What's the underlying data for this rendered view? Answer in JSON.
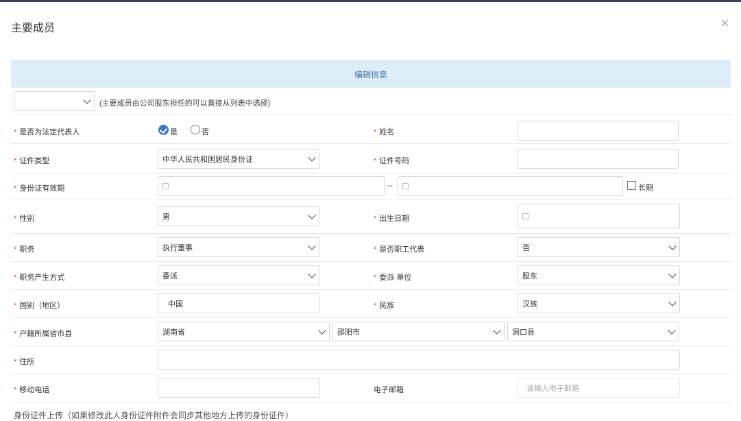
{
  "dialog": {
    "title": "主要成员"
  },
  "section": {
    "title": "编辑信息"
  },
  "member_select": {
    "value": "",
    "hint": "(主要成员由公司股东担任的可以直接从列表中选择)"
  },
  "form": {
    "legal_rep": {
      "label": "是否为法定代表人",
      "yes": "是",
      "no": "否",
      "selected": "是"
    },
    "name": {
      "label": "姓名",
      "value": ""
    },
    "id_type": {
      "label": "证件类型",
      "value": "中华人民共和国居民身份证"
    },
    "id_number": {
      "label": "证件号码",
      "value": ""
    },
    "id_validity": {
      "label": "身份证有效期",
      "start": "",
      "end": "",
      "separator": "--",
      "long_term": "长期"
    },
    "gender": {
      "label": "性别",
      "value": "男"
    },
    "birth_date": {
      "label": "出生日期",
      "value": ""
    },
    "position": {
      "label": "职务",
      "value": "执行董事"
    },
    "employee_rep": {
      "label": "是否职工代表",
      "value": "否"
    },
    "appoint_method": {
      "label": "职务产生方式",
      "value": "委派"
    },
    "appoint_unit": {
      "label": "委派 单位",
      "value": "股东"
    },
    "country": {
      "label": "国别（地区）",
      "value": "中国"
    },
    "ethnicity": {
      "label": "民族",
      "value": "汉族"
    },
    "hukou": {
      "label": "户籍所属省市县",
      "province": "湖南省",
      "city": "邵阳市",
      "county": "洞口县"
    },
    "address": {
      "label": "住所",
      "value": ""
    },
    "mobile": {
      "label": "移动电话",
      "value": ""
    },
    "email": {
      "label": "电子邮箱",
      "placeholder": "请输入电子邮箱"
    }
  },
  "upload": {
    "label": "身份证件上传（如果修改此人身份证件附件会同步其他地方上传的身份证件）"
  }
}
